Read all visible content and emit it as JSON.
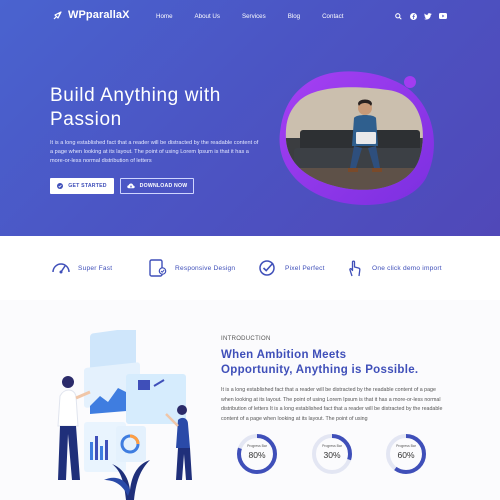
{
  "brand": {
    "name": "WPparallaX"
  },
  "nav": {
    "items": [
      "Home",
      "About Us",
      "Services",
      "Blog",
      "Contact"
    ],
    "icons": [
      "search-icon",
      "facebook-icon",
      "twitter-icon",
      "youtube-icon"
    ]
  },
  "hero": {
    "title": "Build Anything with Passion",
    "description": "It is a long established fact that a reader will be distracted by the readable content of a page when looking at its layout. The point of using Lorem Ipsum is that it has a more-or-less normal distribution of letters",
    "primary_button": "GET STARTED",
    "secondary_button": "DOWNLOAD NOW",
    "colors": {
      "gradient_start": "#4a63cf",
      "gradient_end": "#5048b8",
      "blob": "#9b3df0"
    }
  },
  "features": [
    {
      "label": "Super Fast",
      "icon": "speedometer-icon"
    },
    {
      "label": "Responsive Design",
      "icon": "responsive-devices-icon"
    },
    {
      "label": "Pixel Perfect",
      "icon": "check-badge-icon"
    },
    {
      "label": "One click demo import",
      "icon": "hand-pointer-icon"
    }
  ],
  "about": {
    "kicker": "INTRODUCTION",
    "title": "When Ambition Meets Opportunity, Anything is Possible.",
    "description": "It is a long established fact that a reader will be distracted by the readable content of a page when looking at its layout. The point of using Lorem Ipsum is that it has a more-or-less normal distribution of letters  It is a long established fact that a reader will be distracted by the readable content of a page when looking at its layout. The point of using",
    "progress": [
      {
        "label": "Progress Bar",
        "value": 0.8,
        "value_text": "80%"
      },
      {
        "label": "Progress Bar",
        "value": 0.3,
        "value_text": "30%"
      },
      {
        "label": "Progress Bar",
        "value": 0.6,
        "value_text": "60%"
      }
    ],
    "colors": {
      "accent": "#3f4fb9",
      "track": "#e3e6f3"
    }
  }
}
